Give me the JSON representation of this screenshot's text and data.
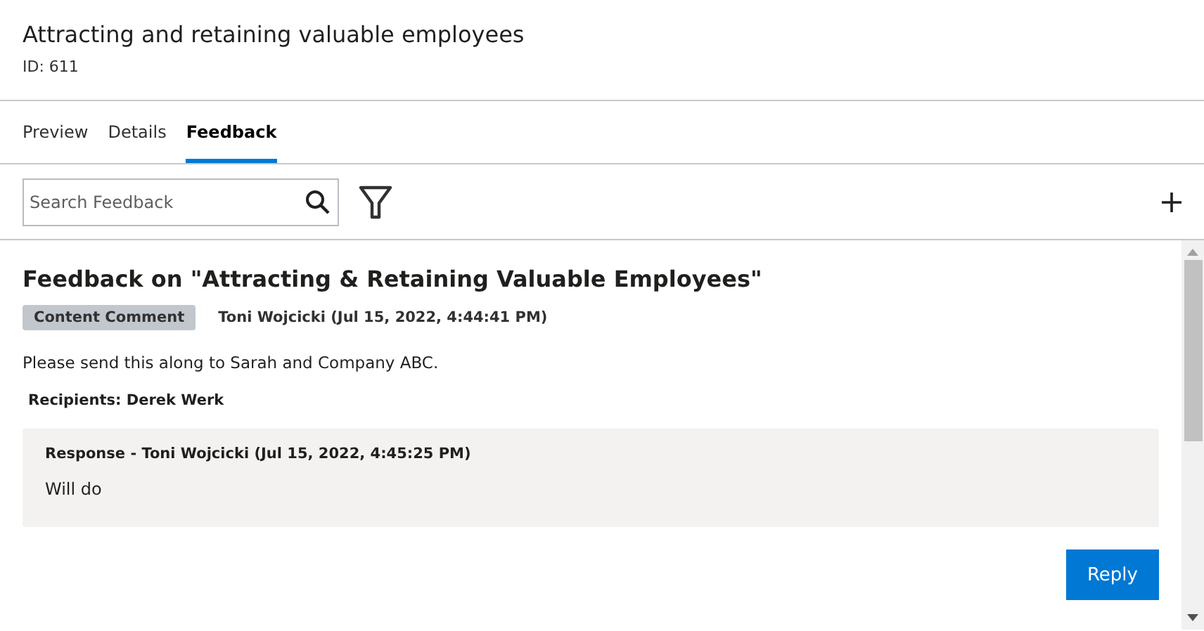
{
  "header": {
    "title": "Attracting and retaining valuable employees",
    "id_label": "ID: 611"
  },
  "tabs": [
    {
      "label": "Preview",
      "selected": false
    },
    {
      "label": "Details",
      "selected": false
    },
    {
      "label": "Feedback",
      "selected": true
    }
  ],
  "toolbar": {
    "search": {
      "placeholder": "Search Feedback"
    }
  },
  "feedback": {
    "title": "Feedback on \"Attracting & Retaining Valuable Employees\"",
    "tag": "Content Comment",
    "author": "Toni Wojcicki (Jul 15, 2022, 4:44:41 PM)",
    "message": "Please send this along to Sarah and Company ABC.",
    "recipients": "Recipients: Derek Werk",
    "responses": [
      {
        "header": "Response - Toni Wojcicki (Jul 15, 2022, 4:45:25 PM)",
        "text": "Will do"
      }
    ],
    "reply_button": "Reply"
  }
}
